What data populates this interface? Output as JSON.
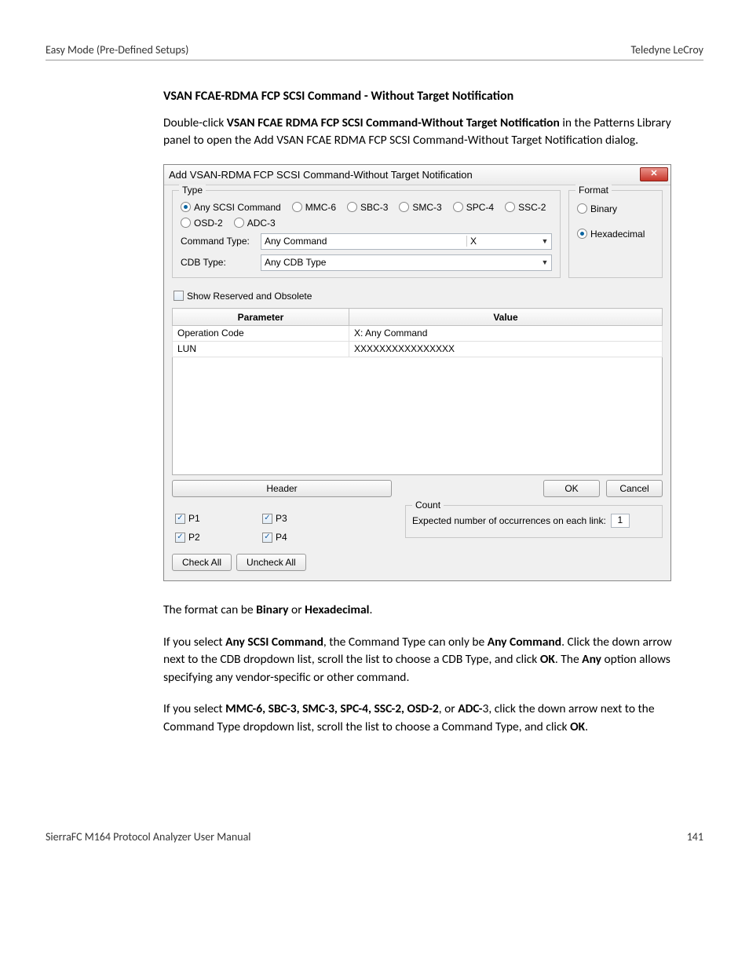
{
  "header": {
    "left": "Easy Mode (Pre-Defined Setups)",
    "right": "Teledyne LeCroy"
  },
  "section": {
    "heading": "VSAN FCAE-RDMA FCP SCSI Command - Without Target Notification",
    "p1_pre": "Double-click ",
    "p1_bold": "VSAN FCAE RDMA FCP SCSI Command-Without Target Notification",
    "p1_post": " in the Patterns Library panel to open the Add VSAN FCAE RDMA FCP SCSI Command-Without Target Notification dialog."
  },
  "dialog": {
    "title": "Add VSAN-RDMA FCP SCSI Command-Without Target Notification",
    "close": "✕",
    "type": {
      "legend": "Type",
      "options": [
        "Any SCSI Command",
        "MMC-6",
        "SBC-3",
        "SMC-3",
        "SPC-4",
        "SSC-2",
        "OSD-2",
        "ADC-3"
      ],
      "selected": "Any SCSI Command",
      "command_type_label": "Command Type:",
      "command_type_value": "Any Command",
      "command_type_extra": "X",
      "cdb_type_label": "CDB Type:",
      "cdb_type_value": "Any CDB Type"
    },
    "format": {
      "legend": "Format",
      "options": [
        "Binary",
        "Hexadecimal"
      ],
      "selected": "Hexadecimal"
    },
    "show_reserved": {
      "label": "Show Reserved and Obsolete",
      "checked": false
    },
    "table": {
      "cols": [
        "Parameter",
        "Value"
      ],
      "rows": [
        {
          "param": "Operation Code",
          "value": "X: Any Command"
        },
        {
          "param": "LUN",
          "value": "XXXXXXXXXXXXXXXX"
        }
      ]
    },
    "header_button": "Header",
    "ok": "OK",
    "cancel": "Cancel",
    "ports": {
      "items": [
        {
          "label": "P1",
          "checked": true
        },
        {
          "label": "P3",
          "checked": true
        },
        {
          "label": "P2",
          "checked": true
        },
        {
          "label": "P4",
          "checked": true
        }
      ]
    },
    "count": {
      "legend": "Count",
      "label": "Expected number of occurrences on each link:",
      "value": "1"
    },
    "check_all": "Check All",
    "uncheck_all": "Uncheck All"
  },
  "body": {
    "p2_a": "The format can be ",
    "p2_b": "Binary",
    "p2_c": " or ",
    "p2_d": "Hexadecimal",
    "p2_e": ".",
    "p3_a": "If you select ",
    "p3_b": "Any SCSI Command",
    "p3_c": ", the Command Type can only be ",
    "p3_d": "Any Command",
    "p3_e": ". Click the down arrow next to the CDB dropdown list, scroll the list to choose a CDB Type, and click ",
    "p3_f": "OK",
    "p3_g": ". The ",
    "p3_h": "Any",
    "p3_i": " option allows specifying any vendor-specific or other command.",
    "p4_a": "If you select ",
    "p4_b": "MMC-6, SBC-3, SMC-3, SPC-4, SSC-2, OSD-2",
    "p4_c": ", or ",
    "p4_d": "ADC-",
    "p4_e": "3, click the down arrow next to the Command Type dropdown list, scroll the list to choose a Command Type, and click ",
    "p4_f": "OK",
    "p4_g": "."
  },
  "footer": {
    "left": "SierraFC M164 Protocol Analyzer User Manual",
    "right": "141"
  }
}
